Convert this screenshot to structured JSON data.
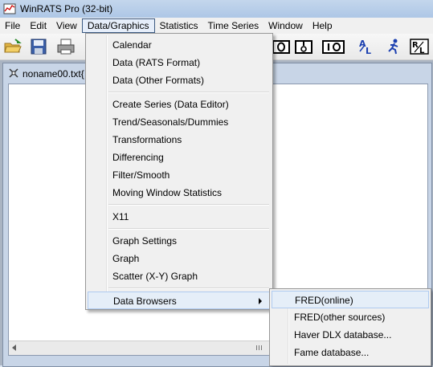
{
  "window": {
    "title": "WinRATS Pro (32-bit)"
  },
  "menubar": {
    "items": [
      "File",
      "Edit",
      "View",
      "Data/Graphics",
      "Statistics",
      "Time Series",
      "Window",
      "Help"
    ]
  },
  "document": {
    "title": "noname00.txt{"
  },
  "dropdown": {
    "items": [
      "Calendar",
      "Data (RATS Format)",
      "Data (Other Formats)",
      "Create Series (Data Editor)",
      "Trend/Seasonals/Dummies",
      "Transformations",
      "Differencing",
      "Filter/Smooth",
      "Moving Window Statistics",
      "X11",
      "Graph Settings",
      "Graph",
      "Scatter (X-Y) Graph",
      "Data Browsers"
    ]
  },
  "submenu": {
    "items": [
      "FRED(online)",
      "FRED(other sources)",
      "Haver DLX database...",
      "Fame database..."
    ]
  },
  "toolbar": {
    "icons": [
      "open-folder-icon",
      "save-disk-icon",
      "print-icon",
      "io-box-icon",
      "io-split-icon",
      "io-icon",
      "al-icon",
      "run-figure-icon",
      "rl-icon"
    ]
  }
}
